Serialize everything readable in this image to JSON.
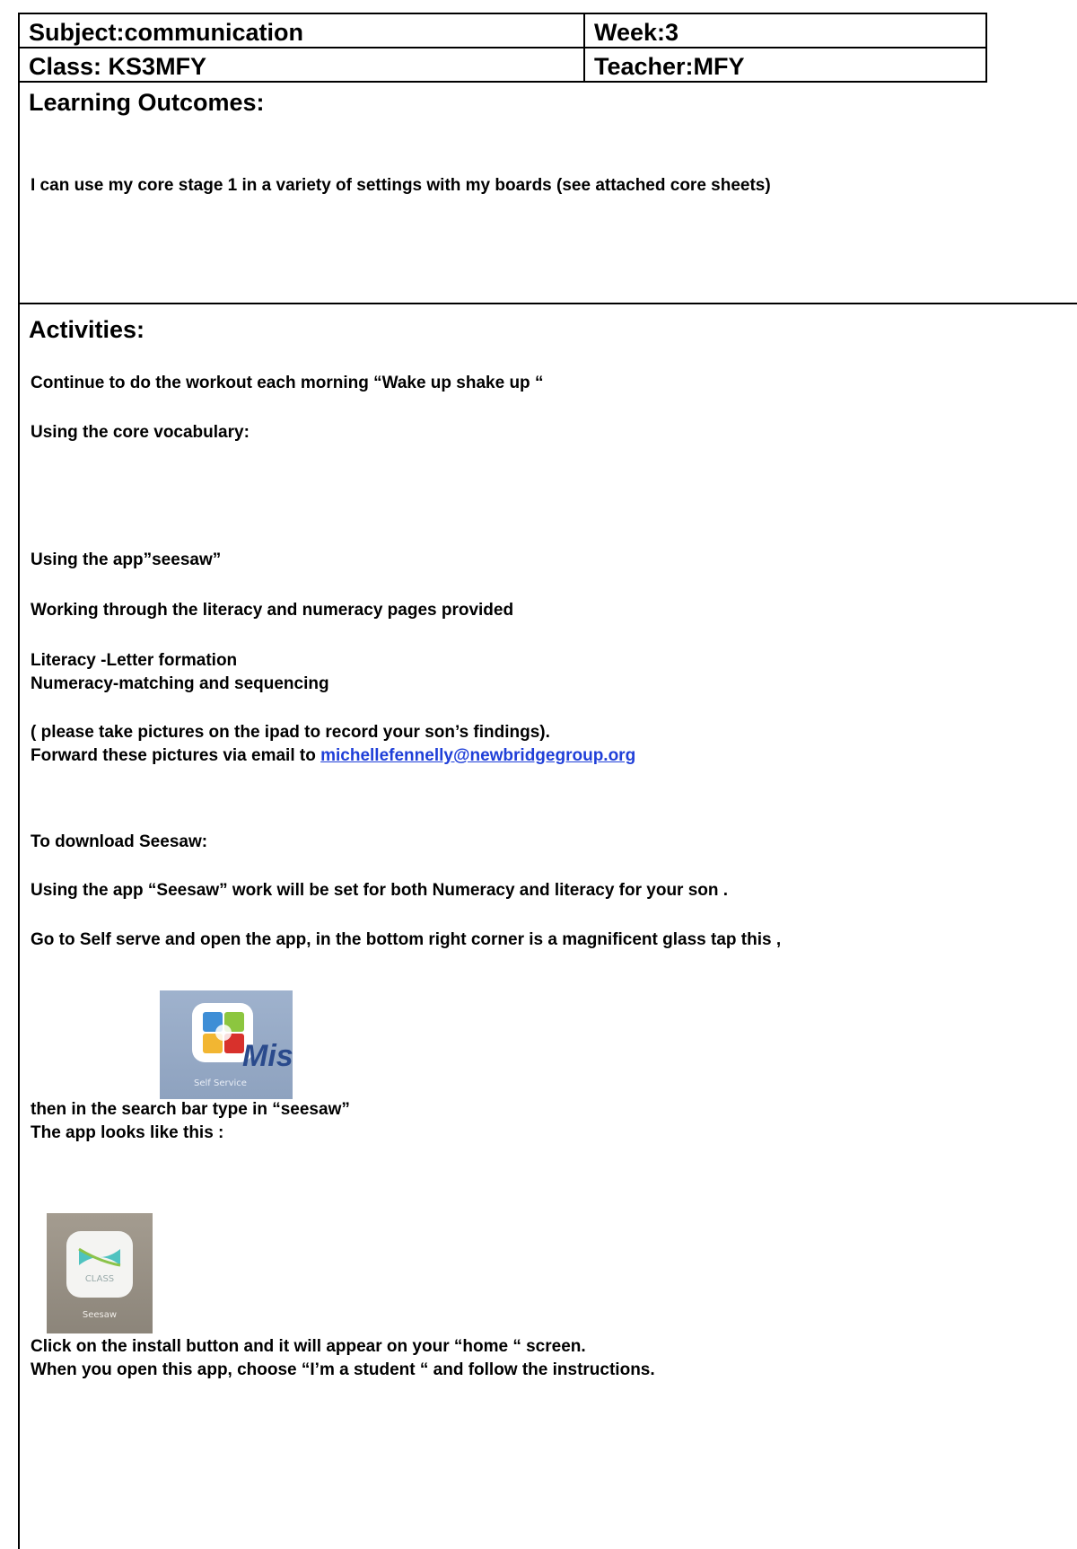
{
  "header": {
    "subject": "Subject:communication",
    "week": "Week:3",
    "class": "Class: KS3MFY",
    "teacher": "Teacher:MFY"
  },
  "learning_outcomes": {
    "heading": "Learning Outcomes:",
    "text": "I can use my core stage 1 in a variety of settings with my boards   (see attached core sheets)"
  },
  "activities": {
    "heading": "Activities:",
    "line1": "Continue to do the workout each morning “Wake up shake up “",
    "line2": "Using the  core vocabulary:",
    "line3": "Using the app”seesaw”",
    "line4": " Working through the literacy and numeracy pages provided",
    "line5": "Literacy -Letter formation",
    "line6": "Numeracy-matching and sequencing",
    "line7": "( please take pictures on the ipad to record your son’s findings).",
    "line8_prefix": "Forward these pictures via email to ",
    "email": "michellefennelly@newbridgegroup.org",
    "line9": "To download Seesaw:",
    "line10": "Using the app “Seesaw” work will be set for both Numeracy and literacy for your son .",
    "line11": " Go to Self serve and open the app, in the bottom right corner is a magnificent glass tap this ,",
    "self_service_img_text": "Self Service",
    "line12": "then in the search bar type in “seesaw”",
    "line13": "The app looks like this :",
    "seesaw_icon_text1": "CLASS",
    "seesaw_icon_text2": "Seesaw",
    "line14": " Click on the install button and it will appear on your “home “ screen.",
    "line15": "When you open this app, choose “I’m a student “ and follow the instructions."
  },
  "colors": {
    "link": "#1f3fd8",
    "border": "#000000",
    "self_service_bg": "#8fa3c2",
    "seesaw_bg": "#9a9386"
  },
  "icons": [
    "self-service-app-icon",
    "seesaw-class-app-icon"
  ]
}
